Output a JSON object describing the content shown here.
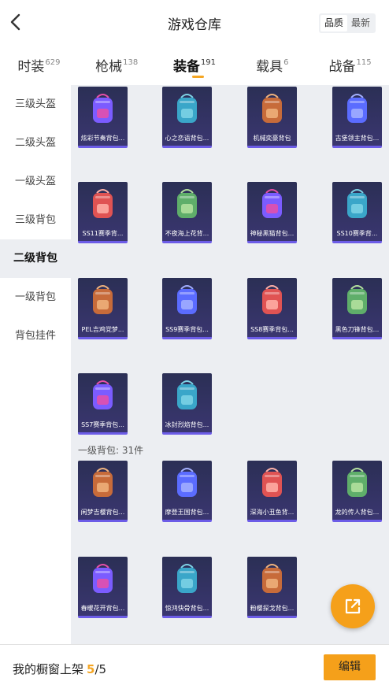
{
  "header": {
    "title": "游戏仓库",
    "toggle": {
      "quality": "品质",
      "newest": "最新",
      "selected": "quality"
    }
  },
  "tabs": [
    {
      "label": "时装",
      "count": "629"
    },
    {
      "label": "枪械",
      "count": "138"
    },
    {
      "label": "装备",
      "count": "191",
      "active": true
    },
    {
      "label": "载具",
      "count": "6"
    },
    {
      "label": "战备",
      "count": "115"
    }
  ],
  "sidebar": {
    "items": [
      "三级头盔",
      "二级头盔",
      "一级头盔",
      "三级背包",
      "二级背包",
      "一级背包",
      "背包挂件"
    ],
    "active_index": 4
  },
  "grid": {
    "rows": [
      [
        "炫彩节奏背包...",
        "心之恋语背包...",
        "机械奕豪背包",
        "古堡领主背包..."
      ],
      [
        "SS11赛季背...",
        "不夜海上花背...",
        "神秘黑猫背包...",
        "SS10赛季背..."
      ],
      [
        "PEL吉鸡党梦...",
        "SS9赛季背包...",
        "SS8赛季背包...",
        "黑色刀锋背包..."
      ],
      [
        "SS7赛季背包...",
        "冰封烈焰背包..."
      ]
    ],
    "section_title": "一级背包: 31件",
    "section_rows": [
      [
        "闲梦吉樱背包...",
        "摩登王国背包...",
        "深海小丑鱼背...",
        "龙的传人背包..."
      ],
      [
        "春暖花开背包...",
        "惊鸿快骨背包...",
        "粉樱探戈背包...",
        ""
      ]
    ]
  },
  "colors": {
    "accent": "#f5a623",
    "card_bg": "#2b2f55",
    "card_border": "#6c5ce7",
    "content_bg": "#eceef2"
  },
  "fab": {
    "icon": "external-link-icon"
  },
  "footer": {
    "label": "我的橱窗上架",
    "current": "5",
    "separator": "/",
    "total": "5",
    "edit_label": "编辑"
  }
}
